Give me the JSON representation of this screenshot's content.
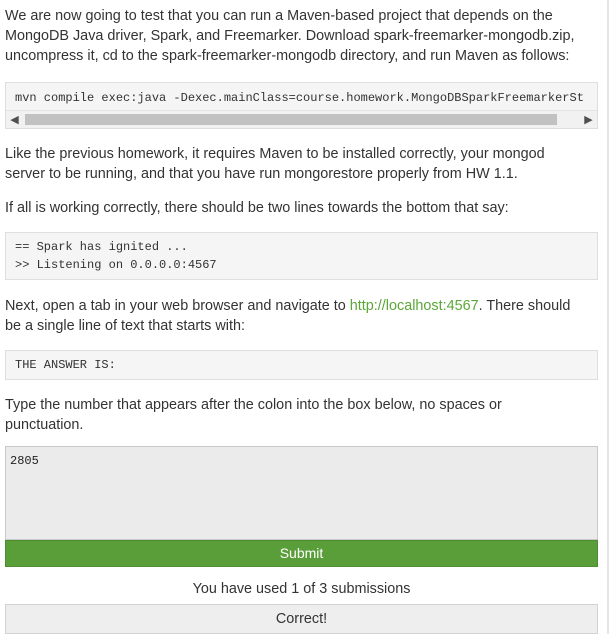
{
  "intro": {
    "line1": "We are now going to test that you can run a Maven-based project that depends on the",
    "line2": "MongoDB Java driver, Spark, and Freemarker. Download spark-freemarker-mongodb.zip,",
    "line3": "uncompress it, cd to the spark-freemarker-mongodb directory, and run Maven as follows:"
  },
  "maven_command": "mvn compile exec:java -Dexec.mainClass=course.homework.MongoDBSparkFreemarkerSt",
  "scroll_left_icon": "◀",
  "scroll_right_icon": "▶",
  "prereq": {
    "line1": "Like the previous homework, it requires Maven to be installed correctly, your mongod",
    "line2": "server to be running, and that you have run mongorestore properly from HW 1.1."
  },
  "expect_text": "If all is working correctly, there should be two lines towards the bottom that say:",
  "spark_output": [
    "== Spark has ignited ...",
    ">> Listening on 0.0.0.0:4567"
  ],
  "browse": {
    "before_link": "Next, open a tab in your web browser and navigate to ",
    "link": "http://localhost:4567",
    "after_link": ". There should",
    "line2": "be a single line of text that starts with:"
  },
  "answer_prefix": "THE ANSWER IS:",
  "instruction": {
    "line1": "Type the number that appears after the colon into the box below, no spaces or",
    "line2": "punctuation."
  },
  "answer_value": "2805",
  "submit_label": "Submit",
  "submissions_text": "You have used 1 of 3 submissions",
  "result_text": "Correct!",
  "colors": {
    "submit": "#5a9e3a",
    "link": "#5aa838",
    "code_bg": "#f5f5f5",
    "answer_bg": "#ebebeb"
  }
}
